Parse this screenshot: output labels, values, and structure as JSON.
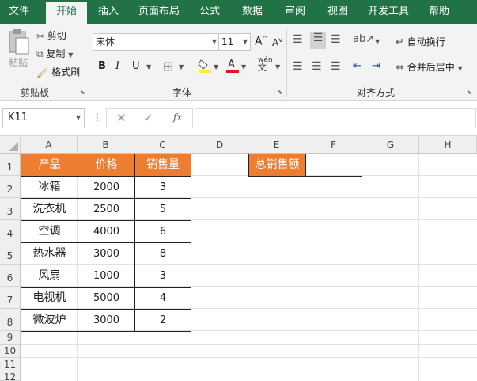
{
  "tabs": [
    "文件",
    "开始",
    "插入",
    "页面布局",
    "公式",
    "数据",
    "审阅",
    "视图",
    "开发工具",
    "帮助"
  ],
  "clipboard": {
    "paste": "粘贴",
    "cut": "剪切",
    "copy": "复制",
    "format_painter": "格式刷",
    "group": "剪贴板"
  },
  "font": {
    "name": "宋体",
    "size": "11",
    "bold": "B",
    "italic": "I",
    "underline": "U",
    "group": "字体",
    "grow": "A",
    "shrink": "A",
    "fill_color": "#ffeb3b",
    "font_color": "#e81123",
    "wen": "wén"
  },
  "alignment": {
    "wrap": "自动换行",
    "merge": "合并后居中",
    "group": "对齐方式"
  },
  "formula_bar": {
    "name_box": "K11",
    "fx": "fx",
    "value": ""
  },
  "columns": [
    "A",
    "B",
    "C",
    "D",
    "E",
    "F",
    "G",
    "H"
  ],
  "rows": [
    "1",
    "2",
    "3",
    "4",
    "5",
    "6",
    "7",
    "8",
    "9",
    "10",
    "11",
    "12"
  ],
  "table": {
    "headers": [
      "产品",
      "价格",
      "销售量"
    ],
    "rows": [
      [
        "冰箱",
        "2000",
        "3"
      ],
      [
        "洗衣机",
        "2500",
        "5"
      ],
      [
        "空调",
        "4000",
        "6"
      ],
      [
        "热水器",
        "3000",
        "8"
      ],
      [
        "风扇",
        "1000",
        "3"
      ],
      [
        "电视机",
        "5000",
        "4"
      ],
      [
        "微波炉",
        "3000",
        "2"
      ]
    ]
  },
  "summary_label": "总销售额",
  "summary_value": "",
  "colors": {
    "excel_green": "#217346",
    "header_orange": "#ed7d31"
  }
}
